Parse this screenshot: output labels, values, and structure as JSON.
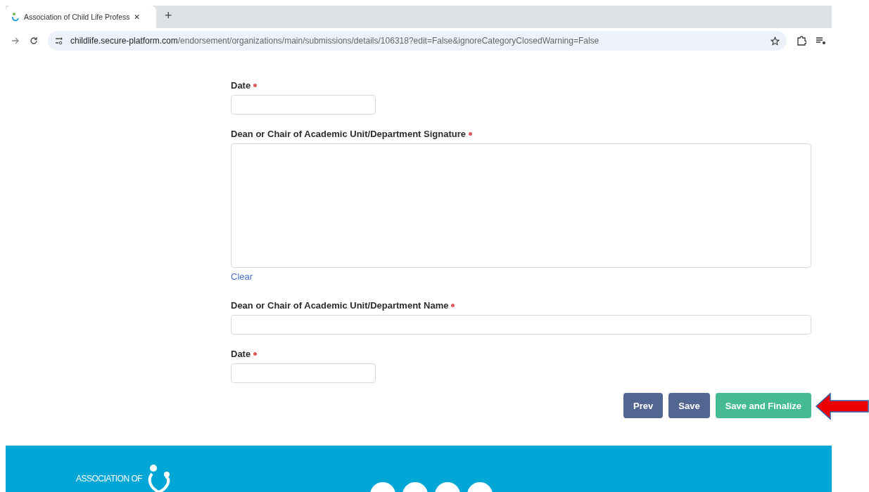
{
  "browser": {
    "tab_title": "Association of Child Life Profess",
    "tab_close": "×",
    "new_tab": "+",
    "url_host": "childlife.secure-platform.com",
    "url_path": "/endorsement/organizations/main/submissions/details/106318?edit=False&ignoreCategoryClosedWarning=False"
  },
  "fields": [
    {
      "kind": "date",
      "label": "Date",
      "required": true
    },
    {
      "kind": "signature",
      "label": "Dean or Chair of Academic Unit/Department Signature",
      "required": true,
      "clear": "Clear"
    },
    {
      "kind": "text",
      "label": "Dean or Chair of Academic Unit/Department Name",
      "required": true
    },
    {
      "kind": "date",
      "label": "Date",
      "required": true
    }
  ],
  "buttons": [
    {
      "label": "Prev",
      "kind": "secondary"
    },
    {
      "label": "Save",
      "kind": "secondary"
    },
    {
      "label": "Save and Finalize",
      "kind": "primary"
    }
  ],
  "footer": {
    "logo_text": "ASSOCIATION OF"
  }
}
